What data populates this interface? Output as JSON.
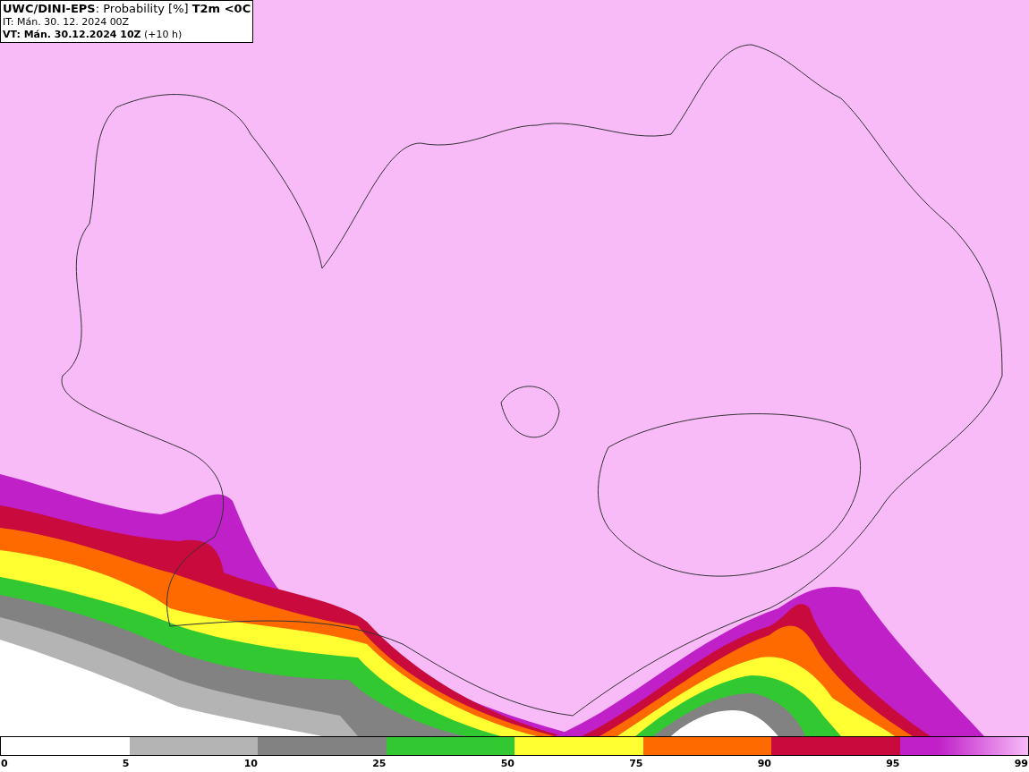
{
  "header": {
    "lines": [
      "**UWC/DINI-EPS**: Probability [%] **T2m <0C**",
      "IT: Mán. 30. 12. 2024 00Z",
      "**VT: Mán. 30.12.2024 10Z** (+10 h)"
    ]
  },
  "legend": {
    "segments": [
      {
        "color": "#ffffff"
      },
      {
        "color": "#b4b4b4"
      },
      {
        "color": "#828282"
      },
      {
        "color": "#32c832"
      },
      {
        "color": "#ffff32"
      },
      {
        "color": "#ff6a00"
      },
      {
        "color": "#c80a3c"
      },
      {
        "color": "#c020c8"
      }
    ],
    "ticks": [
      "0",
      "5",
      "10",
      "25",
      "50",
      "75",
      "90",
      "95",
      "99"
    ]
  }
}
